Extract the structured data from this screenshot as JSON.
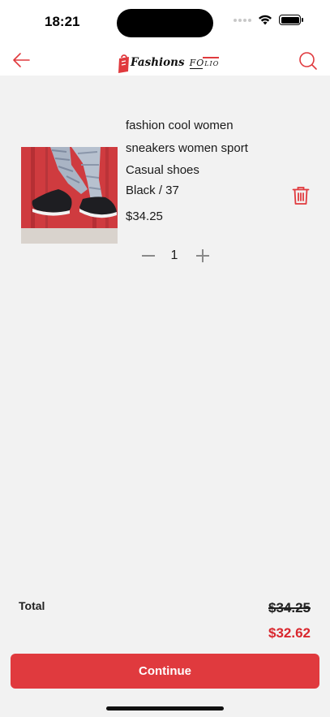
{
  "status_bar": {
    "time": "18:21"
  },
  "header": {
    "logo_text_main": "Fashions",
    "logo_text_fo": "FO",
    "logo_text_lio": "LIO",
    "back_icon": "arrow-left-icon",
    "search_icon": "search-icon",
    "accent_color": "#e03a3e"
  },
  "cart": {
    "items": [
      {
        "name": "fashion cool women sneakers women sport Casual shoes",
        "variant": "Black / 37",
        "price": "$34.25",
        "quantity": "1",
        "delete_icon": "trash-icon"
      }
    ]
  },
  "summary": {
    "total_label": "Total",
    "original_total": "$34.25",
    "discounted_total": "$32.62",
    "discount_color": "#d9272e"
  },
  "actions": {
    "continue_label": "Continue"
  }
}
